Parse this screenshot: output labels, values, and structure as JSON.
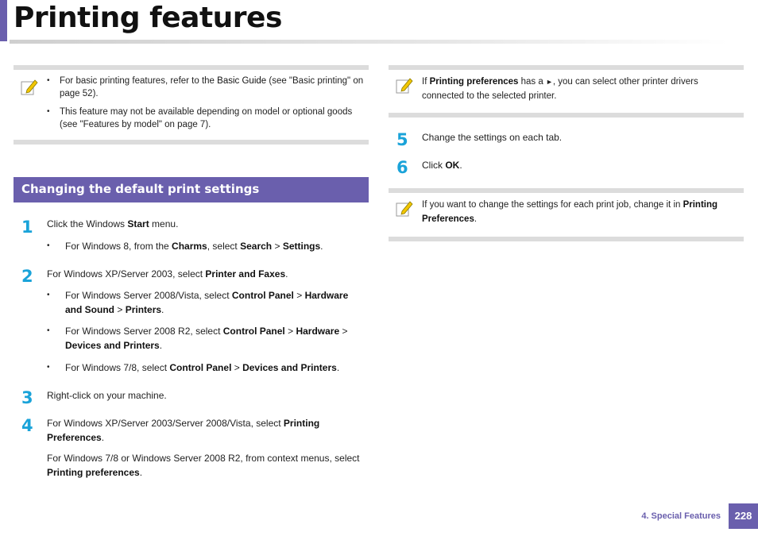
{
  "page": {
    "title": "Printing features",
    "footer_section": "4.  Special Features",
    "page_number": "228"
  },
  "note1": {
    "items": [
      {
        "pre": "For basic printing features, refer to the ",
        "em": "Basic Guide",
        "post": " (see \"Basic printing\" on page 52)."
      },
      {
        "pre": "This feature may not be available depending on model or optional goods (see \"Features by model\" on page 7).",
        "em": "",
        "post": ""
      }
    ]
  },
  "section": {
    "heading": "Changing the default print settings"
  },
  "steps": {
    "s1": {
      "num": "1",
      "pre": "Click the Windows ",
      "b1": "Start",
      "post": " menu."
    },
    "s1_b1": {
      "pre": "For Windows 8, from the ",
      "b1": "Charms",
      "mid1": ", select ",
      "b2": "Search",
      "mid2": " > ",
      "b3": "Settings",
      "post": "."
    },
    "s2": {
      "num": "2",
      "pre": "For Windows XP/Server 2003, select ",
      "b1": "Printer and Faxes",
      "post": "."
    },
    "s2_b1": {
      "pre": "For Windows Server 2008/Vista, select ",
      "b1": "Control Panel",
      "mid1": " > ",
      "b2": "Hardware",
      "line2b": "and Sound",
      "mid2": " > ",
      "b3": "Printers",
      "post": "."
    },
    "s2_b2": {
      "pre": "For Windows Server 2008 R2, select ",
      "b1": "Control Panel",
      "mid1": " > ",
      "b2": "Hardware",
      "mid2": " >",
      "b3": "Devices and Printers",
      "post": "."
    },
    "s2_b3": {
      "pre": "For Windows 7/8, select ",
      "b1": "Control Panel",
      "mid1": " > ",
      "b2": "Devices and Printers",
      "post": "."
    },
    "s3": {
      "num": "3",
      "text": "Right-click on your machine."
    },
    "s4": {
      "num": "4",
      "pre": "For Windows XP/Server 2003/Server 2008/Vista, select ",
      "b1": "Printing",
      "b1b": "Preferences",
      "post": "."
    },
    "s4_p": {
      "pre": "For Windows 7/8 or Windows Server 2008 R2, from context menus, select",
      "b1": "Printing preferences",
      "post": "."
    },
    "s5": {
      "num": "5",
      "text": "Change the settings on each tab."
    },
    "s6": {
      "num": "6",
      "pre": "Click ",
      "b1": "OK",
      "post": "."
    }
  },
  "note2": {
    "pre": "If ",
    "b1": "Printing preferences",
    "mid": " has a ",
    "arrow": "►",
    "post": ", you can select other printer drivers",
    "line2": "connected to the selected printer."
  },
  "note3": {
    "pre": "If you want to change the settings for each print job, change it in ",
    "b1": "Printing",
    "b1b": "Preferences",
    "post": "."
  },
  "icons": {
    "note": "note-pencil-icon"
  },
  "colors": {
    "accent": "#6a5fad",
    "step_number": "#1aa3d9",
    "note_rule": "#dcdcdc"
  }
}
